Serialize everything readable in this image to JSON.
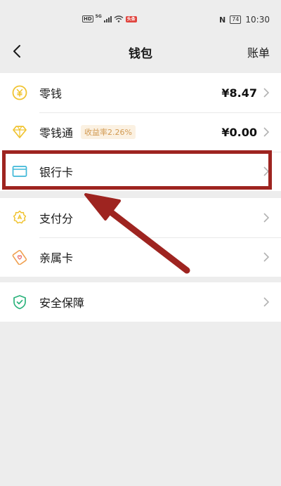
{
  "status_bar": {
    "hd": "HD",
    "net": "5G",
    "red_badge": "头条",
    "nfc": "N",
    "battery": "74",
    "time": "10:30"
  },
  "nav": {
    "title": "钱包",
    "action": "账单",
    "back_icon": "chevron-left-icon"
  },
  "rows": [
    {
      "label": "零钱",
      "value": "¥8.47",
      "icon": "yuan-coin-icon",
      "color": "#f0c330"
    },
    {
      "label": "零钱通",
      "badge": "收益率2.26%",
      "value": "¥0.00",
      "icon": "diamond-icon",
      "color": "#f0c330"
    },
    {
      "label": "银行卡",
      "icon": "bank-card-icon",
      "color": "#3fb8d8"
    },
    {
      "label": "支付分",
      "icon": "pay-score-icon",
      "color": "#f0c330"
    },
    {
      "label": "亲属卡",
      "icon": "family-card-icon",
      "color": "#f0a050"
    },
    {
      "label": "安全保障",
      "icon": "shield-check-icon",
      "color": "#2ab27b"
    }
  ],
  "annotation": {
    "box_color": "#9e2420",
    "arrow_color": "#9e2420"
  }
}
